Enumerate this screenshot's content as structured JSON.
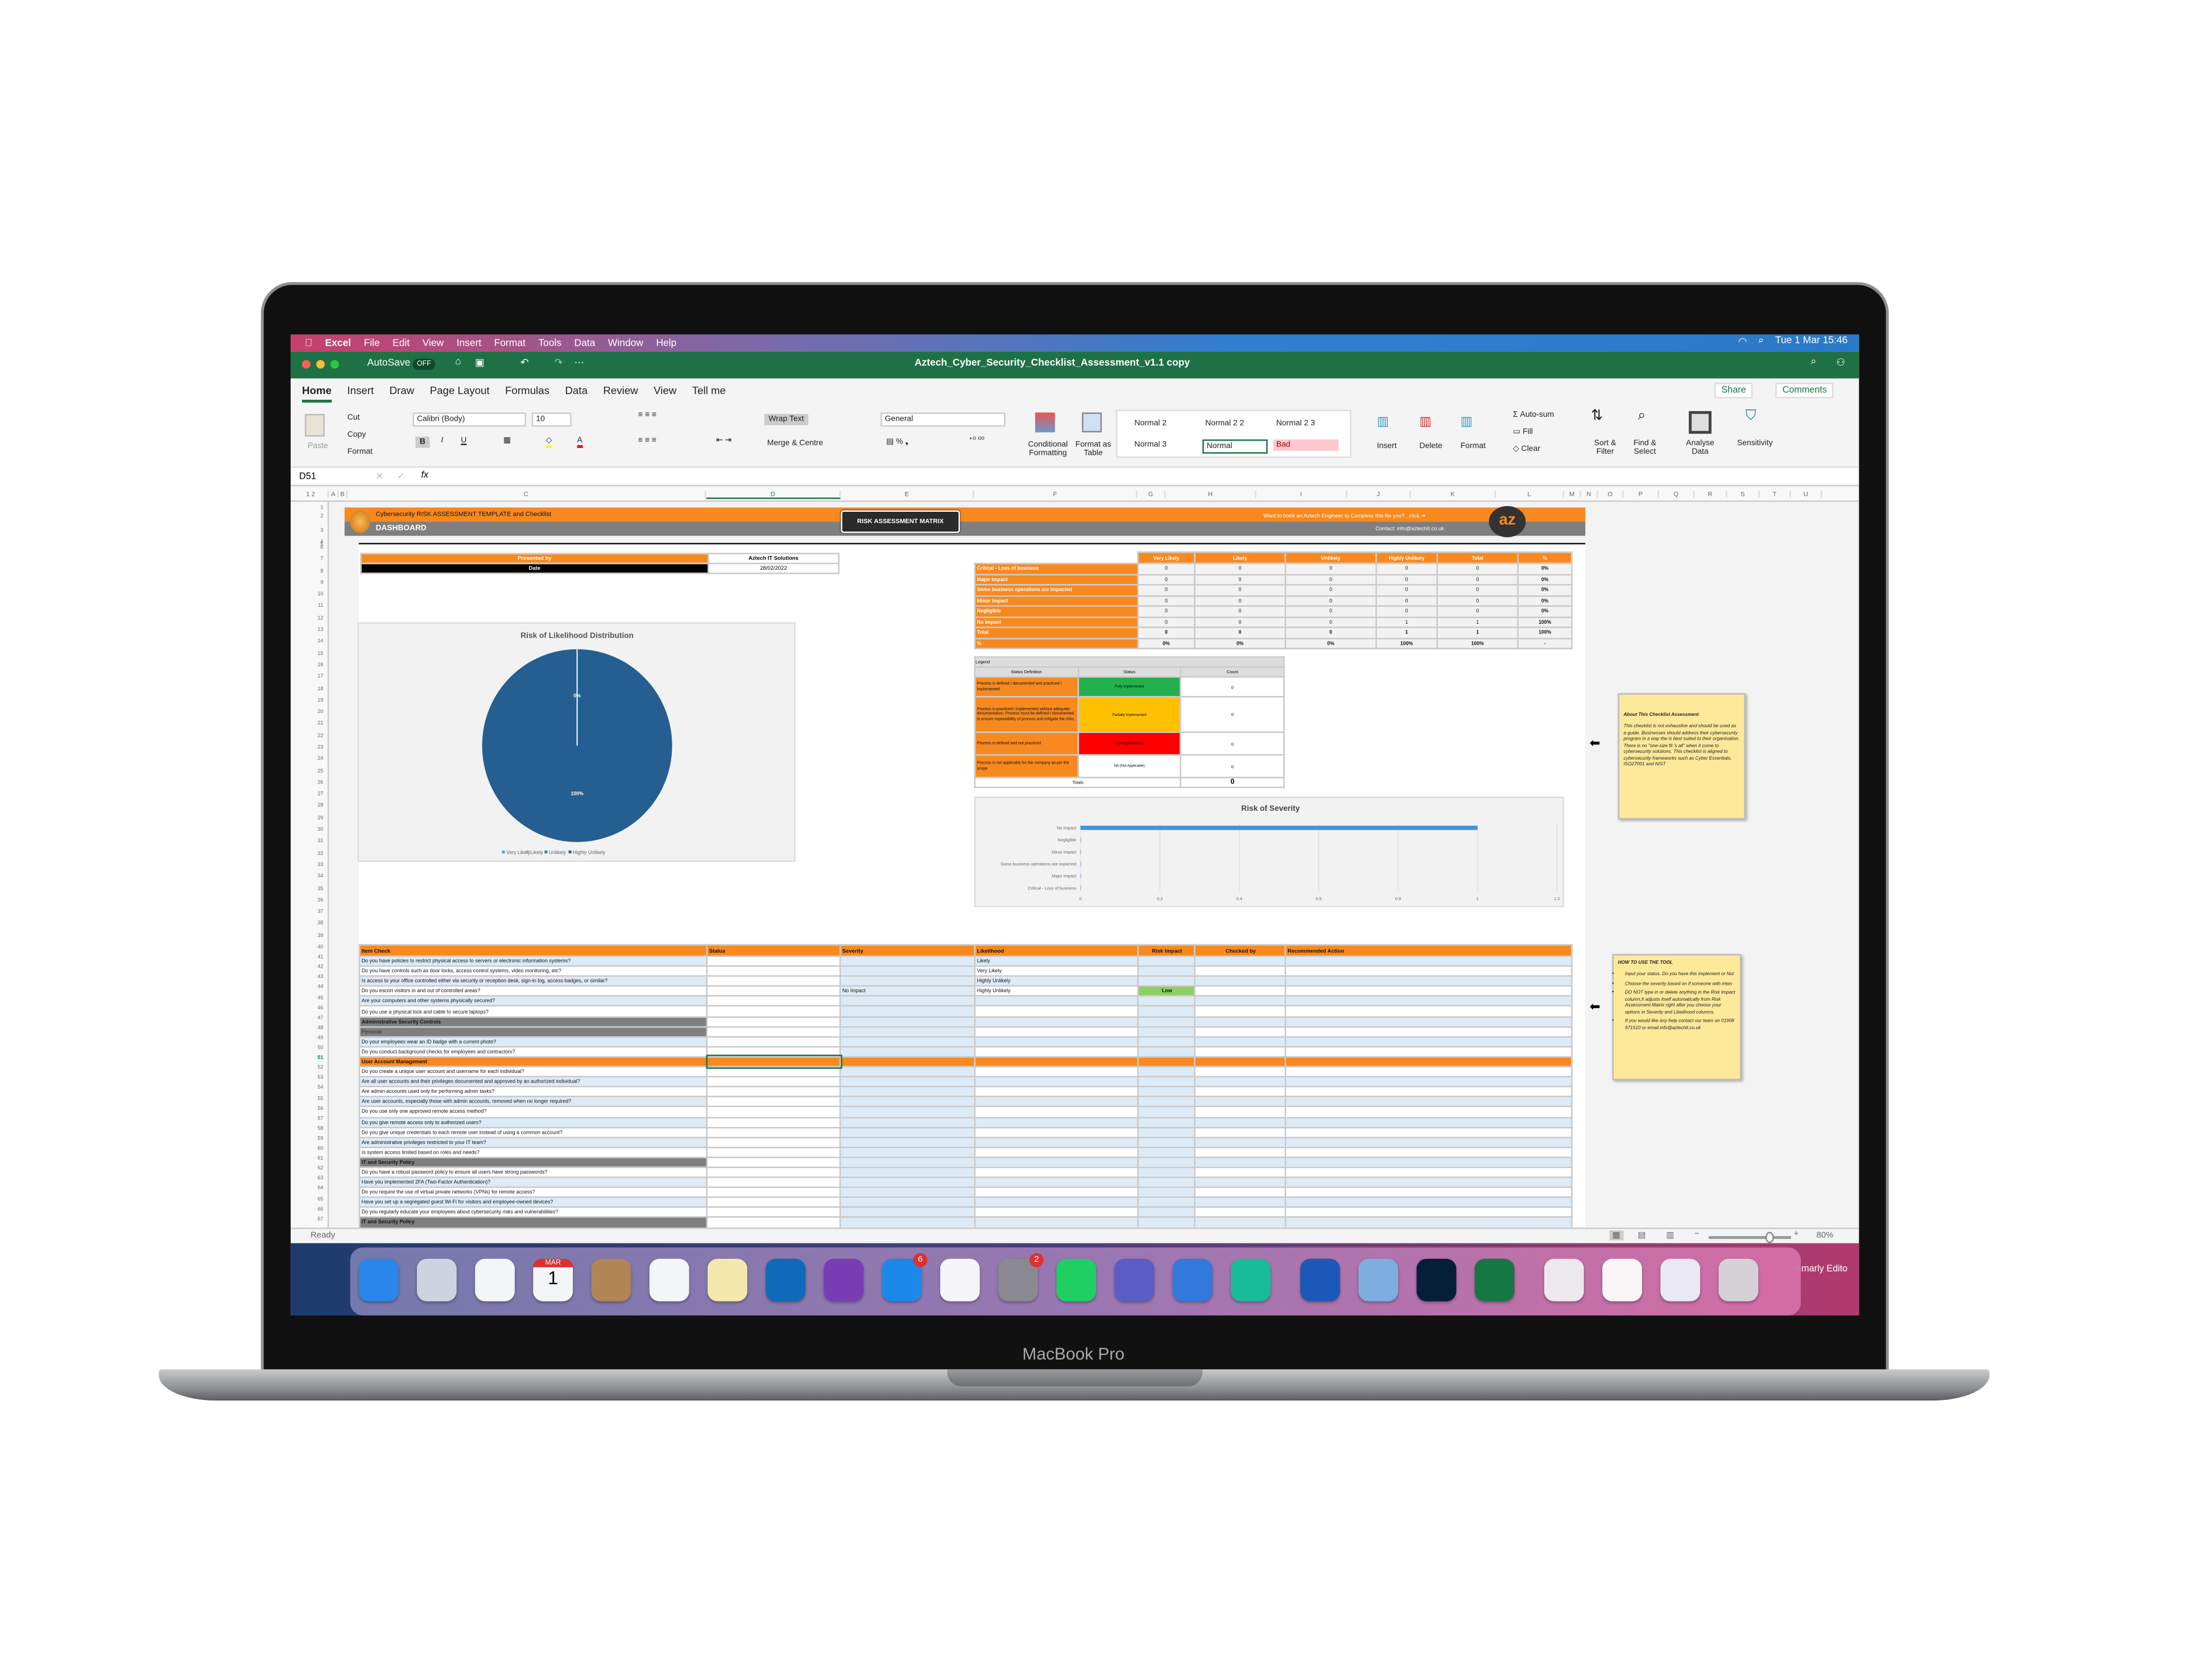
{
  "device": {
    "brand": "MacBook Pro"
  },
  "menubar": {
    "apple": "",
    "items": [
      "Excel",
      "File",
      "Edit",
      "View",
      "Insert",
      "Format",
      "Tools",
      "Data",
      "Window",
      "Help"
    ],
    "clock": "Tue 1 Mar 15:46"
  },
  "titlebar": {
    "autosave": "AutoSave",
    "autosave_state": "OFF",
    "filename": "Aztech_Cyber_Security_Checklist_Assessment_v1.1 copy"
  },
  "ribbon_tabs": [
    "Home",
    "Insert",
    "Draw",
    "Page Layout",
    "Formulas",
    "Data",
    "Review",
    "View",
    "Tell me"
  ],
  "ribbon": {
    "share": "Share",
    "comments": "Comments",
    "paste": "Paste",
    "cut": "Cut",
    "copy": "Copy",
    "format_painter": "Format",
    "font": "Calibri (Body)",
    "font_size": "10",
    "wrap_text": "Wrap Text",
    "merge": "Merge & Centre",
    "number_format": "General",
    "conditional": "Conditional Formatting",
    "format_table": "Format as Table",
    "styles": [
      "Normal 2",
      "Normal 2 2",
      "Normal 2 3",
      "Normal 3",
      "Normal",
      "Bad"
    ],
    "insert": "Insert",
    "delete": "Delete",
    "format": "Format",
    "autosum": "Auto-sum",
    "fill": "Fill",
    "clear": "Clear",
    "sort": "Sort & Filter",
    "find": "Find & Select",
    "analyse": "Analyse Data",
    "sensitivity": "Sensitivity"
  },
  "formula_bar": {
    "cell": "D51",
    "fx": "fx",
    "value": ""
  },
  "columns": [
    "1 2",
    "A",
    "B",
    "C",
    "D",
    "E",
    "F",
    "G",
    "H",
    "I",
    "J",
    "K",
    "L",
    "M",
    "N",
    "O",
    "P",
    "Q",
    "R",
    "S",
    "T",
    "U"
  ],
  "banner": {
    "title": "Cybersecurity RISK ASSESSMENT TEMPLATE and Checklist",
    "subtitle": "DASHBOARD",
    "matrix_button": "RISK ASSESSMENT MATRIX",
    "book_text": "Want to book an Aztech Engineer to Complete this for you? , click ➔",
    "contact": "Contact: info@aztechit.co.uk",
    "logo": "az"
  },
  "presented": {
    "label": "Presented by",
    "value": "Aztech IT Solutions",
    "date_label": "Date",
    "date_value": "28/02/2022"
  },
  "matrix": {
    "headers": [
      "",
      "Very Likely",
      "Likely",
      "Unlikely",
      "Highly Unlikely",
      "Total",
      "%"
    ],
    "rows": [
      [
        "Critical  - Loss of business",
        "0",
        "0",
        "0",
        "0",
        "0",
        "0%"
      ],
      [
        "Major Impact",
        "0",
        "0",
        "0",
        "0",
        "0",
        "0%"
      ],
      [
        "Some business operations are Impacted",
        "0",
        "0",
        "0",
        "0",
        "0",
        "0%"
      ],
      [
        "Minor Impact",
        "0",
        "0",
        "0",
        "0",
        "0",
        "0%"
      ],
      [
        "Negligible",
        "0",
        "0",
        "0",
        "0",
        "0",
        "0%"
      ],
      [
        "No Impact",
        "0",
        "0",
        "0",
        "1",
        "1",
        "100%"
      ],
      [
        "Total",
        "0",
        "0",
        "0",
        "1",
        "1",
        "100%"
      ],
      [
        "%",
        "0%",
        "0%",
        "0%",
        "100%",
        "100%",
        "-"
      ]
    ]
  },
  "legend_table": {
    "title": "Legend",
    "headers": [
      "Status Definition",
      "Status",
      "Count"
    ],
    "rows": [
      {
        "def": "Process is defined / documented and practiced / implemented",
        "status": "Fully Implemented",
        "count": "0",
        "color": "#22b14c"
      },
      {
        "def": "Process is practiced / implemented without adequate documentation; Process must be defined / documented to ensure repeatability of process and mitigate the risks.",
        "status": "Partially Implemented",
        "count": "0",
        "color": "#ffc000"
      },
      {
        "def": "Process is defined and not practiced",
        "status": "Not Implemented",
        "count": "0",
        "color": "#ff0000"
      },
      {
        "def": "Process is not applicable for the company as per the  scope",
        "status": "NA (Not Applicable)",
        "count": "0",
        "color": "#ffffff"
      }
    ],
    "totals_label": "Totals",
    "totals_value": "0"
  },
  "chart_data": [
    {
      "type": "pie",
      "title": "Risk of Likelihood Distribution",
      "categories": [
        "Very Likely",
        "Likely",
        "Unlikely",
        "Highly Unlikely"
      ],
      "values": [
        0,
        0,
        0,
        1
      ],
      "labels": [
        "0%",
        "100%"
      ],
      "colors": [
        "#5b9bd5",
        "#a5a5a5",
        "#4472c4",
        "#255e91"
      ],
      "legend": "bottom"
    },
    {
      "type": "bar",
      "orientation": "horizontal",
      "title": "Risk of Severity",
      "categories": [
        "No Impact",
        "Negligible",
        "Minor Impact",
        "Some business operations are impacted",
        "Major Impact",
        "Critical  - Loss of business"
      ],
      "values": [
        1,
        0,
        0,
        0,
        0,
        0
      ],
      "xlim": [
        0,
        1.2
      ],
      "xticks": [
        "0",
        "0.2",
        "0.4",
        "0.6",
        "0.8",
        "1",
        "1.2"
      ],
      "grid": true,
      "color": "#4a90d9"
    }
  ],
  "checklist": {
    "headers": [
      "Item Check",
      "Status",
      "Severity",
      "Likelihood",
      "Risk Impact",
      "Checked by",
      "Recommended Action"
    ],
    "rows": [
      {
        "item": "Do you have policies to restrict physical access to servers or electronic information systems?",
        "severity": "",
        "likelihood": "Likely",
        "risk": ""
      },
      {
        "item": "Do you have controls such as door locks, access control systems, video monitoring, etc?",
        "severity": "",
        "likelihood": "Very Likely",
        "risk": ""
      },
      {
        "item": "Is access to your office controlled either via security or reception desk, sign-in log, access badges, or similar?",
        "severity": "",
        "likelihood": "Highly Unlikely",
        "risk": ""
      },
      {
        "item": "Do you escort visitors in and out of controlled areas?",
        "severity": "No Impact",
        "likelihood": "Highly Unlikely",
        "risk": "Low"
      },
      {
        "item": "Are your computers and other systems physically secured?",
        "severity": "",
        "likelihood": "",
        "risk": ""
      },
      {
        "item": "Do you use a physical lock and cable to secure laptops?",
        "severity": "",
        "likelihood": "",
        "risk": ""
      },
      {
        "item": "Administrative Security Controls",
        "type": "section"
      },
      {
        "item": "Personal",
        "type": "subsection"
      },
      {
        "item": "Do your employees wear an ID badge with a current photo?"
      },
      {
        "item": "Do you conduct background checks for employees and contractors?"
      },
      {
        "item": "User Account Management",
        "type": "group"
      },
      {
        "item": "Do you create a unique user account and username for each individual?"
      },
      {
        "item": "Are all user accounts and their privileges documented and approved by an authorized individual?"
      },
      {
        "item": "Are admin accounts used only for performing admin tasks?"
      },
      {
        "item": "Are user accounts, especially those with admin accounts, removed when no longer required?"
      },
      {
        "item": "Do you use only one approved remote access method?"
      },
      {
        "item": "Do you give remote access only to authorized users?"
      },
      {
        "item": "Do you give unique credentials to each remote user instead of using a common account?"
      },
      {
        "item": "Are administrative privileges restricted to your IT team?"
      },
      {
        "item": "Is system access limited based on roles and needs?"
      },
      {
        "item": "IT and Security Policy",
        "type": "section"
      },
      {
        "item": "Do you have a robust password policy to ensure all users have strong passwords?"
      },
      {
        "item": "Have you implemented 2FA (Two-Factor Authentication)?"
      },
      {
        "item": "Do you require the use of virtual private networks (VPNs) for remote access?"
      },
      {
        "item": "Have you set up a segregated guest Wi-Fi for visitors and employee-owned devices?"
      },
      {
        "item": "Do you regularly educate your employees about cybersecurity risks and vulnerabilities?"
      },
      {
        "item": "IT and Security Policy",
        "type": "section"
      }
    ]
  },
  "notes": {
    "about_title": "About This Checklist Assessment",
    "about_body": "This checklist is not exhaustive and should be used as a guide. Businesses should address their cybersecurity program in a way the is best suited to their organisation. There is no \"one-size fit 's all\" when it come to cybersecurity solutions. This checklist is aligned to cybersecurity frameworks such as Cyber Essentials, ISO27001 and NIST",
    "howto_title": "HOW TO USE THE TOOL",
    "howto_items": [
      "Input your status. Do you have this implement or Not",
      "Choose the severity based on if someone with inten",
      "DO NOT type in or delete anything in the Risk Impact column,It adjusts itself automatically from Risk Assessment Matrix right after you choose your options in Severity and Likelihood columns.",
      "If you would like any help contact our team on 01908 571510 or email info@aztechit.co.uk"
    ]
  },
  "statusbar": {
    "ready": "Ready",
    "zoom": "80%",
    "zoom_level": 80
  },
  "dock": {
    "apps": [
      {
        "name": "finder",
        "color": "#2a8bf2"
      },
      {
        "name": "launchpad",
        "color": "#d9dbe6"
      },
      {
        "name": "safari",
        "color": "#ffffff"
      },
      {
        "name": "calendar",
        "color": "#ffffff",
        "month": "MAR",
        "day": "1"
      },
      {
        "name": "contacts",
        "color": "#b78a53"
      },
      {
        "name": "reminders",
        "color": "#ffffff"
      },
      {
        "name": "notes",
        "color": "#fff3b0"
      },
      {
        "name": "outlook",
        "color": "#0f6cbd"
      },
      {
        "name": "onenote",
        "color": "#7b3fb8"
      },
      {
        "name": "app-store",
        "color": "#1a8cf0",
        "badge": "6"
      },
      {
        "name": "chrome",
        "color": "#ffffff"
      },
      {
        "name": "system-preferences",
        "color": "#8e8e93",
        "badge": "2"
      },
      {
        "name": "spotify",
        "color": "#1ed760"
      },
      {
        "name": "teams",
        "color": "#5b5fc7"
      },
      {
        "name": "todo",
        "color": "#2f7de1"
      },
      {
        "name": "grammarly",
        "color": "#15c39a"
      },
      {
        "name": "word",
        "color": "#185abd"
      },
      {
        "name": "preview",
        "color": "#7fb3e6"
      },
      {
        "name": "photoshop",
        "color": "#001e36"
      },
      {
        "name": "excel",
        "color": "#107c41"
      },
      {
        "name": "document",
        "color": "#f2f2f2"
      },
      {
        "name": "document",
        "color": "#ffffff"
      },
      {
        "name": "document",
        "color": "#eef2fb"
      },
      {
        "name": "trash",
        "color": "#d8dadd"
      }
    ],
    "window_label": "mmarly Edito"
  }
}
